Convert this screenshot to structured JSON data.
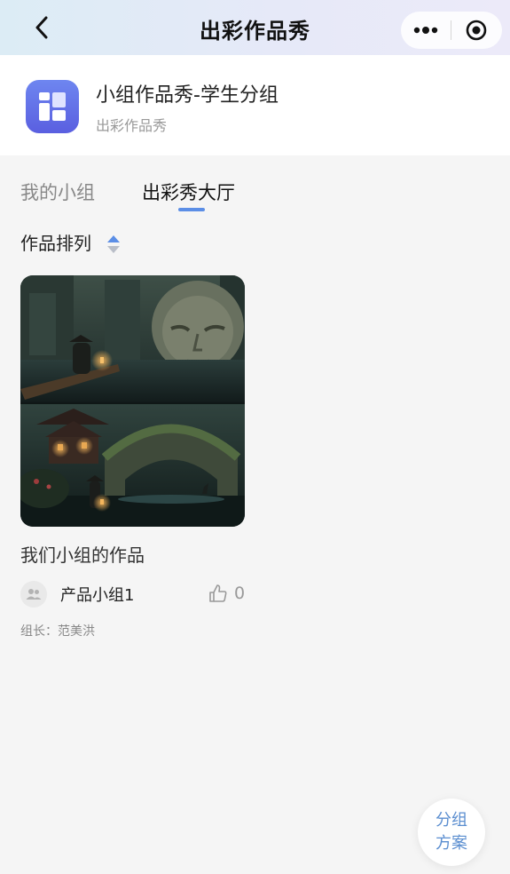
{
  "nav": {
    "title": "出彩作品秀",
    "back_icon": "chevron-left-icon",
    "more_icon": "more-dots-icon",
    "close_icon": "target-circle-icon"
  },
  "app": {
    "title": "小组作品秀-学生分组",
    "subtitle": "出彩作品秀",
    "icon": "layout-grid-icon"
  },
  "tabs": [
    {
      "label": "我的小组",
      "active": false
    },
    {
      "label": "出彩秀大厅",
      "active": true
    }
  ],
  "sort": {
    "label": "作品排列",
    "icon": "sort-arrows-icon"
  },
  "works": [
    {
      "title": "我们小组的作品",
      "group_name": "产品小组1",
      "likes": "0",
      "leader": "组长：范美洪",
      "avatar_icon": "group-people-icon",
      "like_icon": "thumbs-up-icon"
    }
  ],
  "float_button": {
    "line1": "分组",
    "line2": "方案"
  },
  "colors": {
    "accent": "#5b8ee6",
    "app_icon": "#6a72ea",
    "float_text": "#5b8ed0",
    "background": "#f5f5f5"
  }
}
